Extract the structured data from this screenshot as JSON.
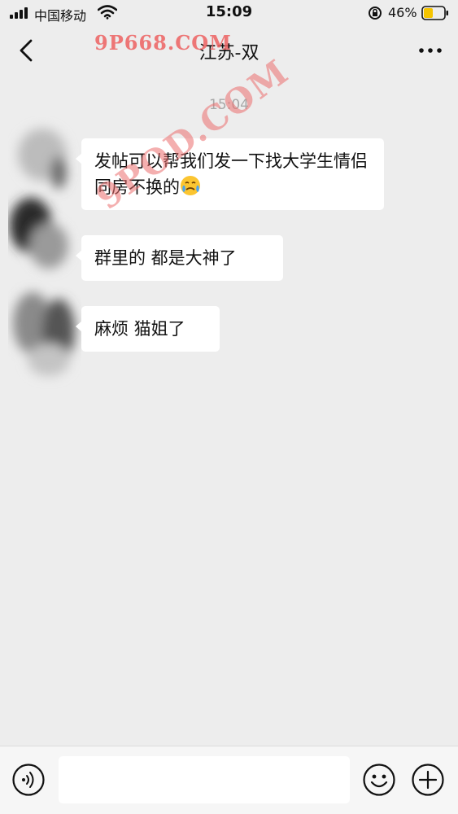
{
  "status_bar": {
    "carrier": "中国移动",
    "time": "15:09",
    "battery_percent_text": "46%",
    "battery_level": 0.46,
    "icons": [
      "signal-icon",
      "wifi-icon",
      "orientation-lock-icon",
      "battery-icon"
    ]
  },
  "nav": {
    "title": "江苏-双",
    "back_icon": "chevron-left-icon",
    "more_icon": "more-dots-icon"
  },
  "watermarks": {
    "top": "9P668.COM",
    "diagonal": "9POD.COM"
  },
  "chat": {
    "timestamp": "15:04",
    "messages": [
      {
        "text": "发帖可以帮我们发一下找大学生情侣同房不换的",
        "emoji": "crying-face-emoji"
      },
      {
        "text": "群里的 都是大神了"
      },
      {
        "text": "麻烦 猫姐了"
      }
    ]
  },
  "input_bar": {
    "voice_icon": "voice-icon",
    "emoji_icon": "smiley-icon",
    "plus_icon": "plus-icon",
    "placeholder": ""
  },
  "colors": {
    "background": "#ededed",
    "bubble": "#ffffff",
    "timestamp": "#a8a8a8",
    "watermark": "#ec6060",
    "battery_fill": "#f5c400"
  }
}
